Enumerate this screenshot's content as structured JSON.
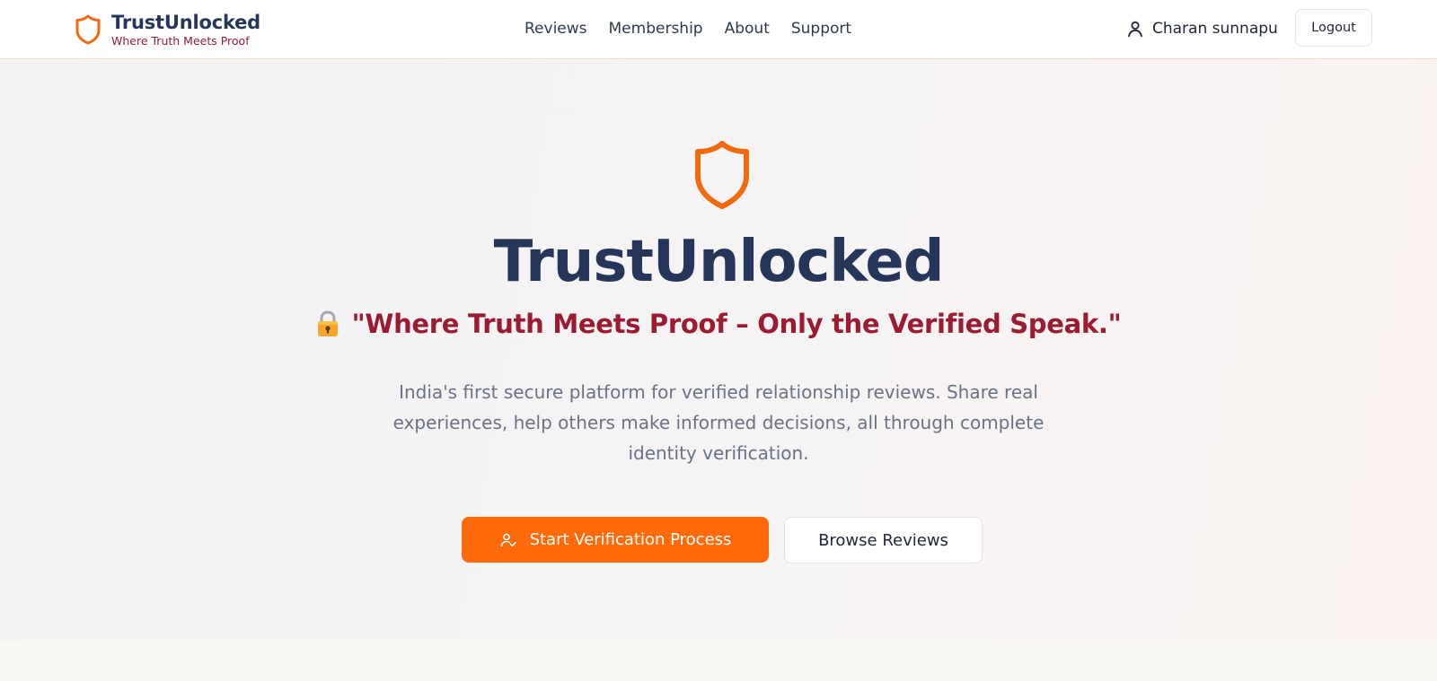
{
  "header": {
    "brand": {
      "title": "TrustUnlocked",
      "tagline": "Where Truth Meets Proof",
      "icon": "shield-icon"
    },
    "nav": [
      "Reviews",
      "Membership",
      "About",
      "Support"
    ],
    "user": {
      "name": "Charan sunnapu",
      "icon": "user-icon"
    },
    "logout_label": "Logout"
  },
  "hero": {
    "icon": "shield-icon",
    "title": "TrustUnlocked",
    "quote_icon": "lock-icon",
    "quote": "\"Where Truth Meets Proof – Only the Verified Speak.\"",
    "description": "India's first secure platform for verified relationship reviews. Share real experiences, help others make informed decisions, all through complete identity verification.",
    "primary_button": {
      "label": "Start Verification Process",
      "icon": "user-check-icon"
    },
    "secondary_button": {
      "label": "Browse Reviews"
    }
  },
  "colors": {
    "accent": "#ff6a0b",
    "brand_navy": "#26365a",
    "quote_red": "#9b1b33",
    "muted_text": "#6a7285"
  }
}
